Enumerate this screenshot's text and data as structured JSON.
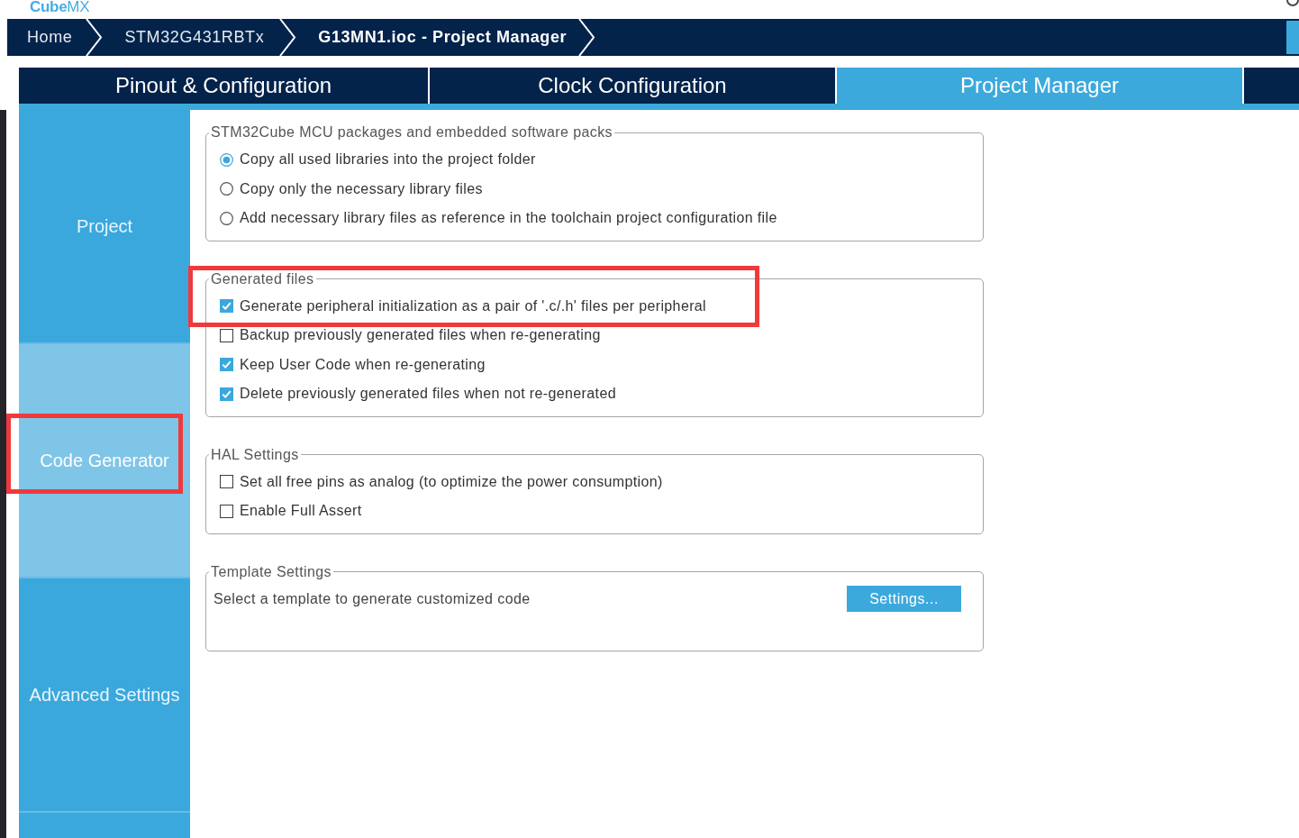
{
  "logo": "**Cube**MX",
  "breadcrumb": [
    {
      "label": "Home",
      "current": false
    },
    {
      "label": "STM32G431RBTx",
      "current": false
    },
    {
      "label": "G13MN1.ioc - Project Manager",
      "current": true
    }
  ],
  "tabs": [
    {
      "label": "Pinout & Configuration",
      "selected": false
    },
    {
      "label": "Clock Configuration",
      "selected": false
    },
    {
      "label": "Project Manager",
      "selected": true
    },
    {
      "selected": false
    }
  ],
  "sidebar": {
    "items": [
      {
        "label": "Project",
        "selected": false,
        "highlighted": false
      },
      {
        "label": "Code Generator",
        "selected": true,
        "highlighted": true
      },
      {
        "label": "Advanced Settings",
        "selected": false,
        "highlighted": false
      },
      {
        "selected": false,
        "highlighted": false
      }
    ]
  },
  "groups": [
    {
      "kind": "options",
      "title": "STM32Cube MCU packages and embedded software packs",
      "options": [
        {
          "kind": "radio",
          "label": "Copy all used libraries into the project folder",
          "selected": true,
          "highlighted": false
        },
        {
          "kind": "radio",
          "label": "Copy only the necessary library files",
          "selected": false,
          "highlighted": false
        },
        {
          "kind": "radio",
          "label": "Add necessary library files as reference in the toolchain project configuration file",
          "selected": false,
          "highlighted": false
        }
      ]
    },
    {
      "kind": "options",
      "title": "Generated files",
      "options": [
        {
          "kind": "checkbox",
          "label": "Generate peripheral initialization as a pair of '.c/.h' files per peripheral",
          "checked": true,
          "highlighted": true
        },
        {
          "kind": "checkbox",
          "label": "Backup previously generated files when re-generating",
          "checked": false,
          "highlighted": false
        },
        {
          "kind": "checkbox",
          "label": "Keep User Code when re-generating",
          "checked": true,
          "highlighted": false
        },
        {
          "kind": "checkbox",
          "label": "Delete previously generated files when not re-generated",
          "checked": true,
          "highlighted": false
        }
      ]
    },
    {
      "kind": "options",
      "title": "HAL Settings",
      "options": [
        {
          "kind": "checkbox",
          "label": "Set all free pins as analog (to optimize the power consumption)",
          "checked": false,
          "highlighted": false
        },
        {
          "kind": "checkbox",
          "label": "Enable Full Assert",
          "checked": false,
          "highlighted": false
        }
      ]
    },
    {
      "kind": "template",
      "title": "Template Settings",
      "text": "Select a template to generate customized code",
      "button": "Settings..."
    }
  ]
}
